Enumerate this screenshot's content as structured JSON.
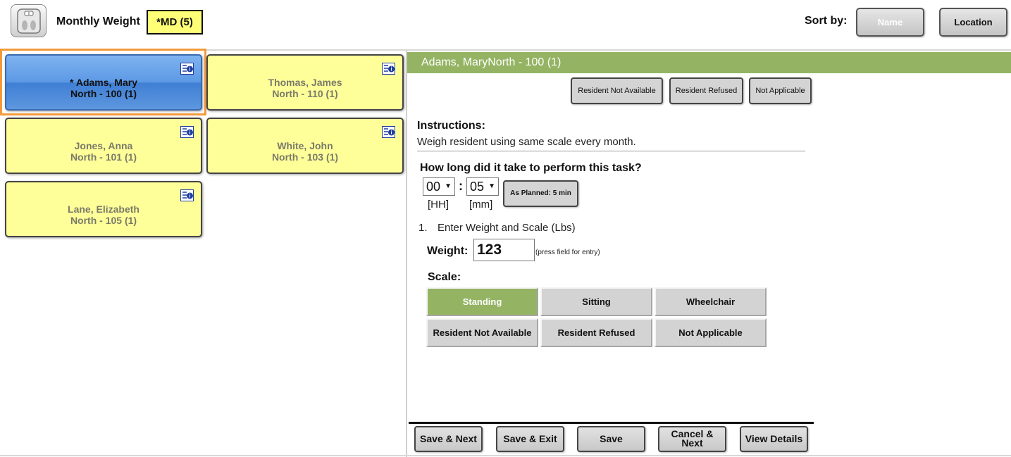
{
  "header": {
    "app_icon": "weight-scale-icon",
    "title": "Monthly Weight",
    "count_badge": "*MD (5)",
    "sort_label": "Sort by:",
    "sort_buttons": [
      "Name",
      "Location"
    ]
  },
  "residents": [
    {
      "name": "* Adams, Mary",
      "location": "North - 100 (1)",
      "selected": true
    },
    {
      "name": "Thomas, James",
      "location": "North - 110 (1)",
      "selected": false
    },
    {
      "name": "Jones, Anna",
      "location": "North - 101 (1)",
      "selected": false
    },
    {
      "name": "White, John",
      "location": "North - 103 (1)",
      "selected": false
    },
    {
      "name": "Lane, Elizabeth",
      "location": "North - 105 (1)",
      "selected": false
    }
  ],
  "detail": {
    "header": "Adams, MaryNorth - 100 (1)",
    "top_buttons": [
      "Resident Not Available",
      "Resident Refused",
      "Not Applicable"
    ],
    "instructions_title": "Instructions:",
    "instructions_text": "Weigh resident using same scale every month.",
    "duration_question": "How long did it take to perform this task?",
    "hours_value": "00",
    "minutes_value": "05",
    "hours_unit": "[HH]",
    "minutes_unit": "[mm]",
    "as_planned": "As Planned: 5 min",
    "step_number": "1.",
    "step_text": "Enter Weight and Scale (Lbs)",
    "weight_label": "Weight:",
    "weight_value": "123",
    "weight_hint": "(press field for entry)",
    "scale_label": "Scale:",
    "scale_options": [
      "Standing",
      "Sitting",
      "Wheelchair",
      "Resident Not Available",
      "Resident Refused",
      "Not Applicable"
    ],
    "scale_selected": "Standing"
  },
  "footer_buttons": [
    "Save & Next",
    "Save & Exit",
    "Save",
    "Cancel & Next",
    "View Details"
  ],
  "colors": {
    "accent_green": "#94b463",
    "card_yellow": "#ffff99",
    "selected_blue": "#5c98e4",
    "selection_orange": "#f39a3c"
  }
}
